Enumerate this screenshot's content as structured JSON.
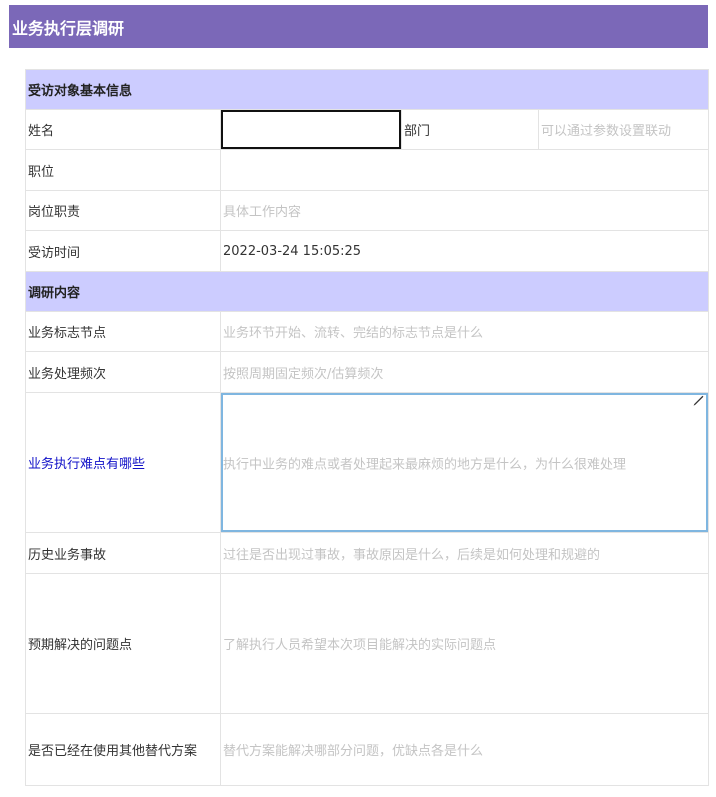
{
  "header": {
    "title": "业务执行层调研"
  },
  "form": {
    "section_basic": "受访对象基本信息",
    "name_label": "姓名",
    "name_value": "",
    "dept_label": "部门",
    "dept_placeholder": "可以通过参数设置联动",
    "position_label": "职位",
    "position_value": "",
    "duty_label": "岗位职责",
    "duty_placeholder": "具体工作内容",
    "time_label": "受访时间",
    "time_value": "2022-03-24 15:05:25",
    "section_content": "调研内容",
    "milestone_label": "业务标志节点",
    "milestone_placeholder": "业务环节开始、流转、完结的标志节点是什么",
    "frequency_label": "业务处理频次",
    "frequency_placeholder": "按照周期固定频次/估算频次",
    "difficulty_label": "业务执行难点有哪些",
    "difficulty_placeholder": "执行中业务的难点或者处理起来最麻烦的地方是什么，为什么很难处理",
    "accident_label": "历史业务事故",
    "accident_placeholder": "过往是否出现过事故，事故原因是什么，后续是如何处理和规避的",
    "expected_label": "预期解决的问题点",
    "expected_placeholder": "了解执行人员希望本次项目能解决的实际问题点",
    "alternative_label": "是否已经在使用其他替代方案",
    "alternative_placeholder": "替代方案能解决哪部分问题，优缺点各是什么"
  }
}
